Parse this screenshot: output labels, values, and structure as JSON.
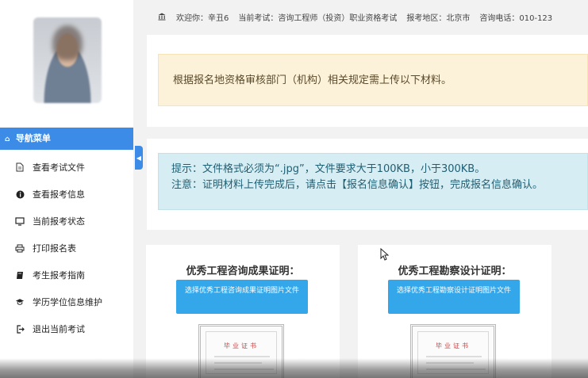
{
  "topbar": {
    "welcome": "欢迎你：辛丑6",
    "exam": "当前考试：咨询工程师（投资）职业资格考试",
    "region": "报考地区：北京市",
    "phone": "咨询电话：010-123"
  },
  "sidebar": {
    "header": "导航菜单",
    "items": [
      {
        "label": "查看考试文件",
        "icon": "file-icon"
      },
      {
        "label": "查看报考信息",
        "icon": "info-icon"
      },
      {
        "label": "当前报考状态",
        "icon": "monitor-icon"
      },
      {
        "label": "打印报名表",
        "icon": "print-icon"
      },
      {
        "label": "考生报考指南",
        "icon": "book-icon"
      },
      {
        "label": "学历学位信息维护",
        "icon": "graduation-cap-icon"
      },
      {
        "label": "退出当前考试",
        "icon": "exit-icon"
      }
    ]
  },
  "notice": {
    "warning": "根据报名地资格审核部门（机构）相关规定需上传以下材料。",
    "tip_line1": "提示：文件格式必须为“.jpg”，文件要求大于100KB，小于300KB。",
    "tip_line2": "注意：证明材料上传完成后，请点击【报名信息确认】按钮，完成报名信息确认。"
  },
  "cards": [
    {
      "title": "优秀工程咨询成果证明：",
      "button": "选择优秀工程咨询成果证明图片文件",
      "cert_title": "毕业证书"
    },
    {
      "title": "优秀工程勘察设计证明：",
      "button": "选择优秀工程勘察设计证明图片文件",
      "cert_title": "毕业证书"
    }
  ],
  "colors": {
    "accent": "#3c8ce7",
    "button": "#34a6ea",
    "warning_bg": "#fcf2d9",
    "info_bg": "#d6edf3"
  }
}
